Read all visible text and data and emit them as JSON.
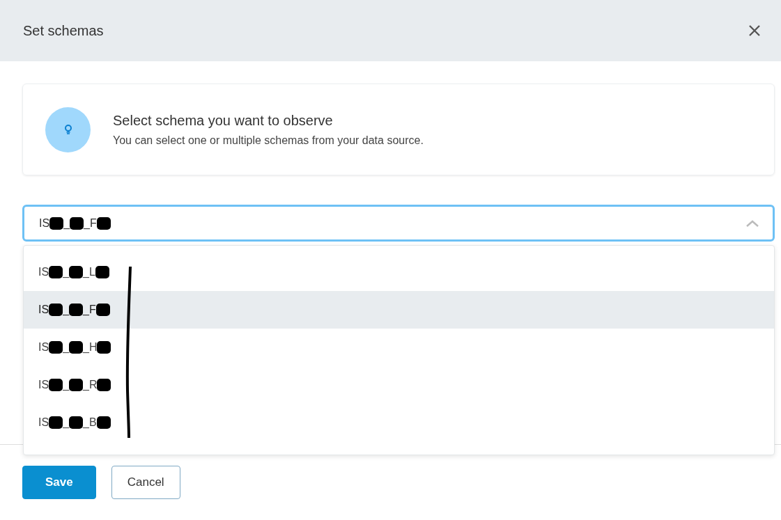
{
  "dialog": {
    "title": "Set schemas"
  },
  "info": {
    "title": "Select schema you want to observe",
    "text": "You can select one or multiple schemas from your data source."
  },
  "select": {
    "expanded": true,
    "value": [
      {
        "kind": "text",
        "text": "IS"
      },
      {
        "kind": "redacted"
      },
      {
        "kind": "text",
        "text": "_"
      },
      {
        "kind": "redacted"
      },
      {
        "kind": "text",
        "text": "_F"
      },
      {
        "kind": "redacted"
      }
    ]
  },
  "options": [
    {
      "selected": false,
      "parts": [
        {
          "kind": "text",
          "text": "IS"
        },
        {
          "kind": "redacted"
        },
        {
          "kind": "text",
          "text": "_"
        },
        {
          "kind": "redacted"
        },
        {
          "kind": "text",
          "text": "_L"
        },
        {
          "kind": "redacted"
        }
      ]
    },
    {
      "selected": true,
      "parts": [
        {
          "kind": "text",
          "text": "IS"
        },
        {
          "kind": "redacted"
        },
        {
          "kind": "text",
          "text": "_"
        },
        {
          "kind": "redacted"
        },
        {
          "kind": "text",
          "text": "_F"
        },
        {
          "kind": "redacted"
        }
      ]
    },
    {
      "selected": false,
      "parts": [
        {
          "kind": "text",
          "text": "IS"
        },
        {
          "kind": "redacted"
        },
        {
          "kind": "text",
          "text": "_"
        },
        {
          "kind": "redacted"
        },
        {
          "kind": "text",
          "text": "_H"
        },
        {
          "kind": "redacted"
        }
      ]
    },
    {
      "selected": false,
      "parts": [
        {
          "kind": "text",
          "text": "IS"
        },
        {
          "kind": "redacted"
        },
        {
          "kind": "text",
          "text": "_"
        },
        {
          "kind": "redacted"
        },
        {
          "kind": "text",
          "text": "_R"
        },
        {
          "kind": "redacted"
        }
      ]
    },
    {
      "selected": false,
      "parts": [
        {
          "kind": "text",
          "text": "IS"
        },
        {
          "kind": "redacted"
        },
        {
          "kind": "text",
          "text": "_"
        },
        {
          "kind": "redacted"
        },
        {
          "kind": "text",
          "text": "_B"
        },
        {
          "kind": "redacted"
        }
      ]
    }
  ],
  "buttons": [
    {
      "label": "Save",
      "kind": "primary"
    },
    {
      "label": "Cancel",
      "kind": "secondary"
    }
  ]
}
